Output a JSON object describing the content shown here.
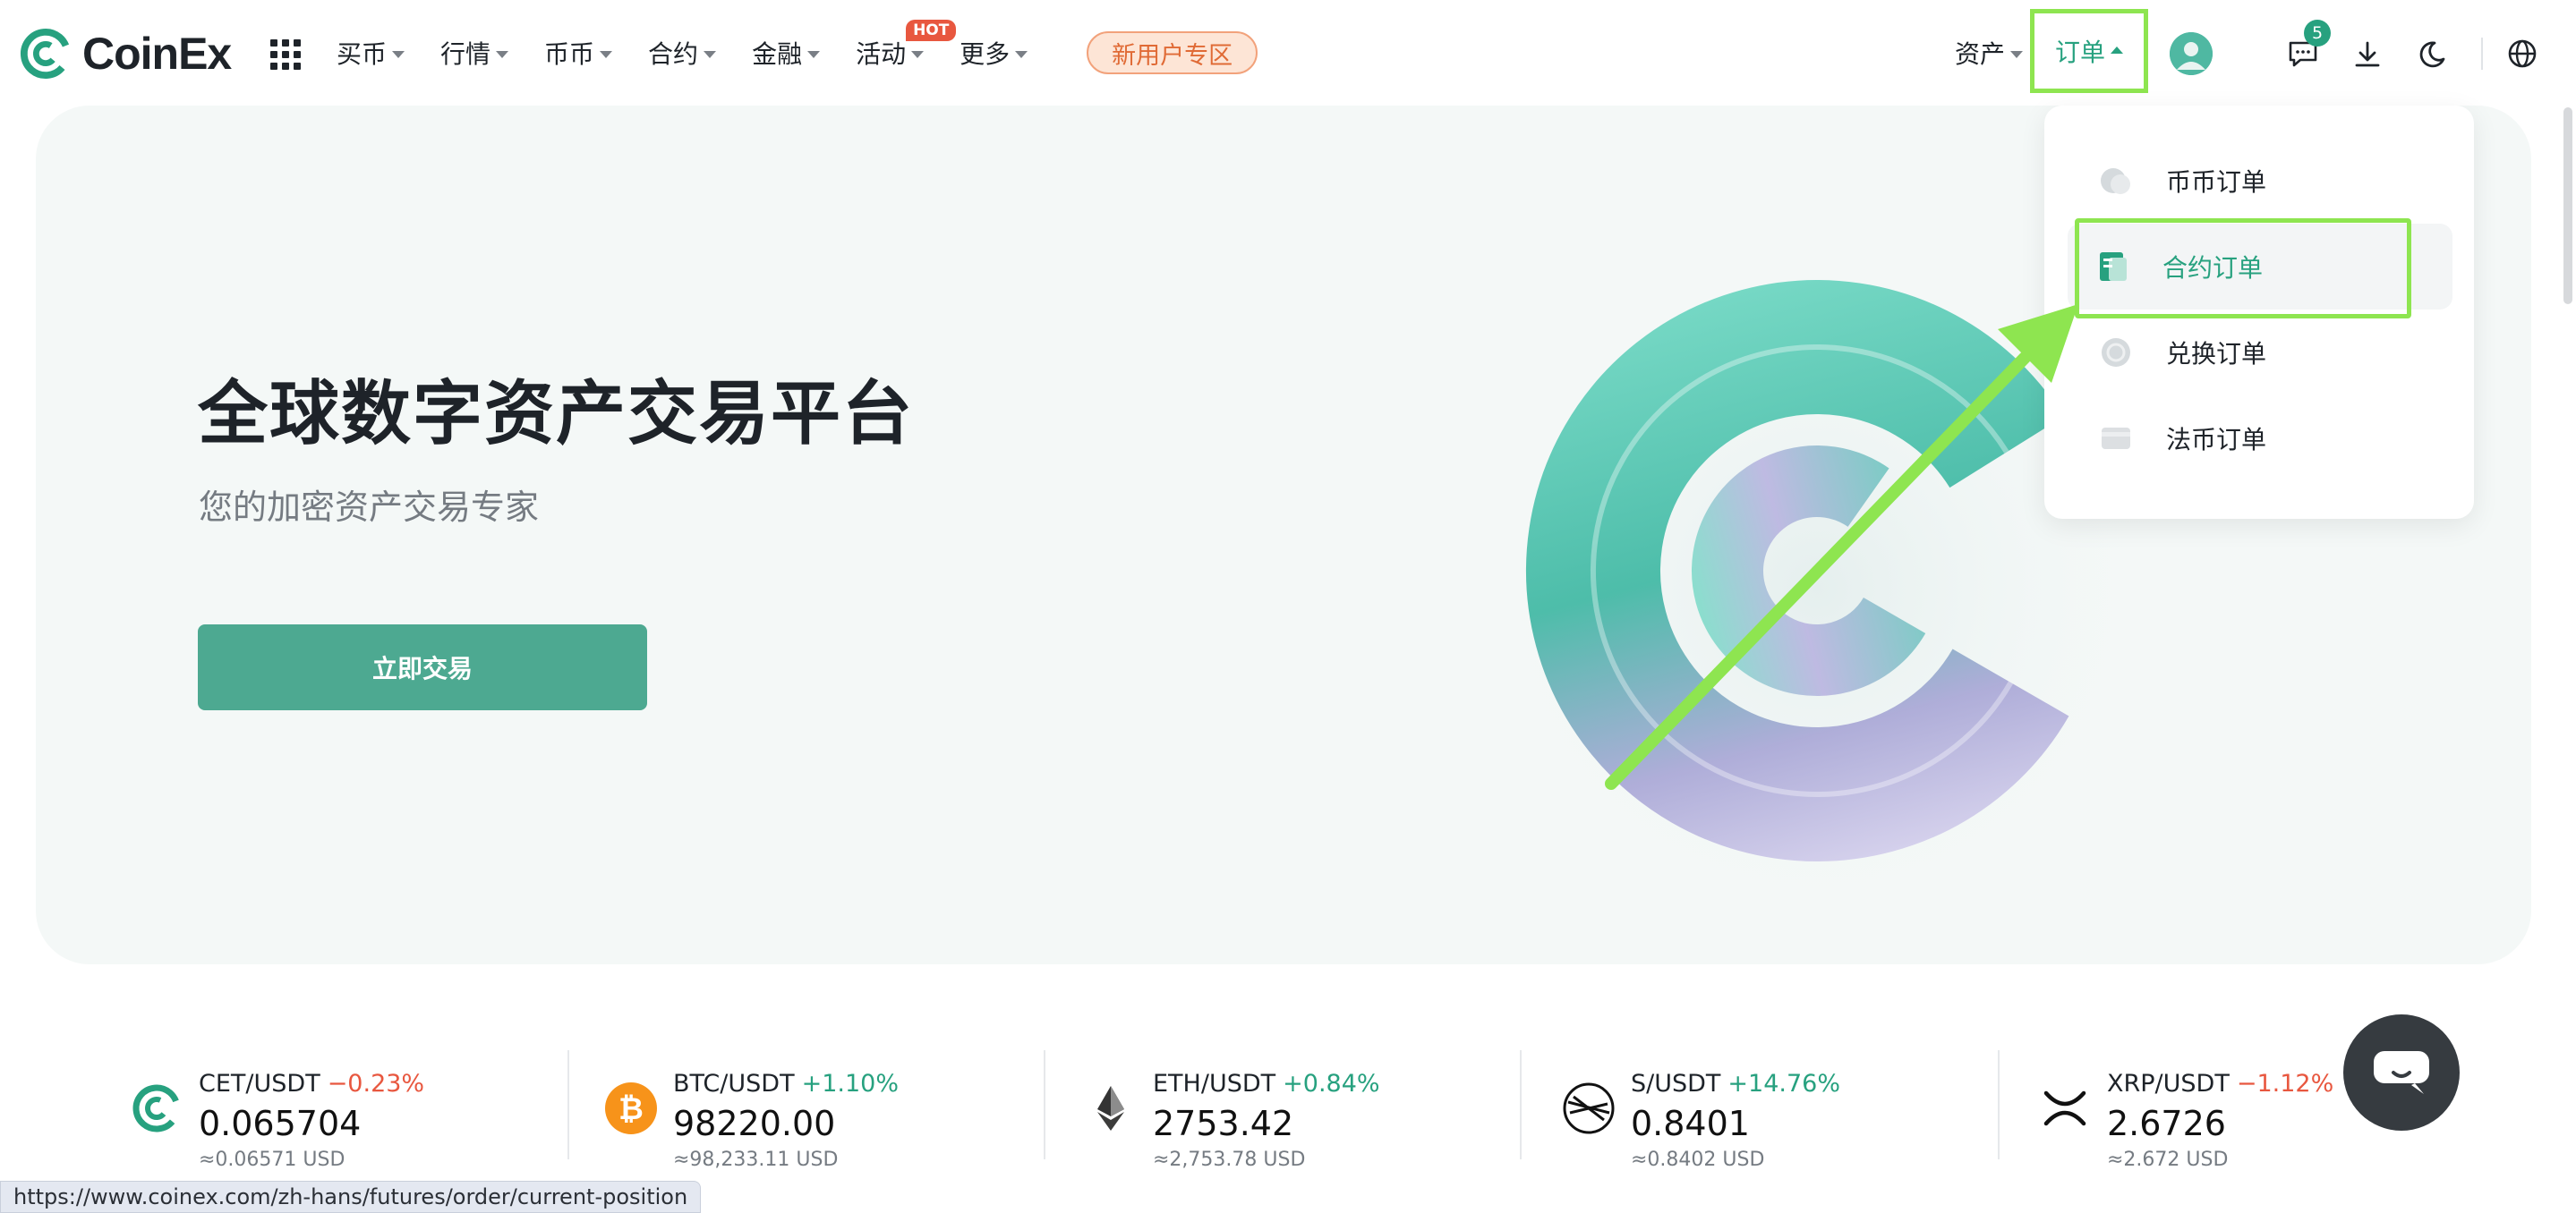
{
  "brand": {
    "name": "CoinEx",
    "color": "#27a17f"
  },
  "nav": {
    "items": [
      {
        "label": "买币"
      },
      {
        "label": "行情"
      },
      {
        "label": "币币"
      },
      {
        "label": "合约"
      },
      {
        "label": "金融"
      },
      {
        "label": "活动",
        "badge": "HOT"
      },
      {
        "label": "更多"
      }
    ],
    "promo": "新用户专区"
  },
  "right_nav": {
    "assets": "资产",
    "orders": "订单",
    "message_count": "5"
  },
  "dropdown": {
    "items": [
      {
        "label": "币币订单",
        "icon": "spot-order-icon"
      },
      {
        "label": "合约订单",
        "icon": "futures-order-icon",
        "active": true
      },
      {
        "label": "兑换订单",
        "icon": "exchange-order-icon"
      },
      {
        "label": "法币订单",
        "icon": "fiat-order-icon"
      }
    ]
  },
  "hero": {
    "title": "全球数字资产交易平台",
    "subtitle": "您的加密资产交易专家",
    "cta": "立即交易"
  },
  "tickers": [
    {
      "pair": "CET/USDT",
      "change": "−0.23%",
      "trend": "down",
      "price": "0.065704",
      "usd": "≈0.06571 USD",
      "icon": "cet-icon"
    },
    {
      "pair": "BTC/USDT",
      "change": "+1.10%",
      "trend": "up",
      "price": "98220.00",
      "usd": "≈98,233.11 USD",
      "icon": "btc-icon"
    },
    {
      "pair": "ETH/USDT",
      "change": "+0.84%",
      "trend": "up",
      "price": "2753.42",
      "usd": "≈2,753.78 USD",
      "icon": "eth-icon"
    },
    {
      "pair": "S/USDT",
      "change": "+14.76%",
      "trend": "up",
      "price": "0.8401",
      "usd": "≈0.8402 USD",
      "icon": "sonic-icon"
    },
    {
      "pair": "XRP/USDT",
      "change": "−1.12%",
      "trend": "down",
      "price": "2.6726",
      "usd": "≈2.672 USD",
      "icon": "xrp-icon"
    }
  ],
  "status_bar": {
    "url": "https://www.coinex.com/zh-hans/futures/order/current-position"
  }
}
